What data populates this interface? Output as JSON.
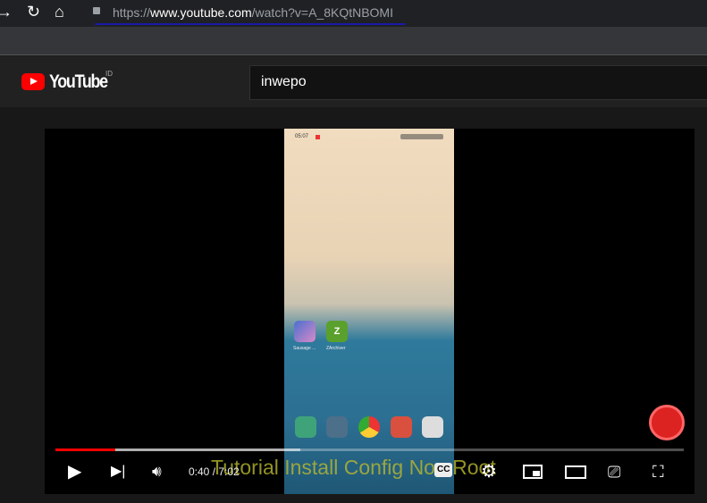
{
  "browser": {
    "url_scheme": "https://",
    "url_host": "www.youtube.com",
    "url_path": "/watch?v=A_8KQtNBOMI"
  },
  "header": {
    "brand": "YouTube",
    "country": "ID",
    "search_value": "inwepo"
  },
  "video": {
    "phone": {
      "clock": "05:07",
      "apps": [
        "Sausage ...",
        "ZArchiver"
      ]
    },
    "caption": "Tutorial Install Config Non Root",
    "current_time": "0:40",
    "duration": "7:02",
    "time_display": "0:40 / 7:02",
    "progress_percent": 9.5,
    "buffered_percent": 39,
    "colors": {
      "progress": "#ff0000",
      "brand": "#ff0000"
    }
  }
}
